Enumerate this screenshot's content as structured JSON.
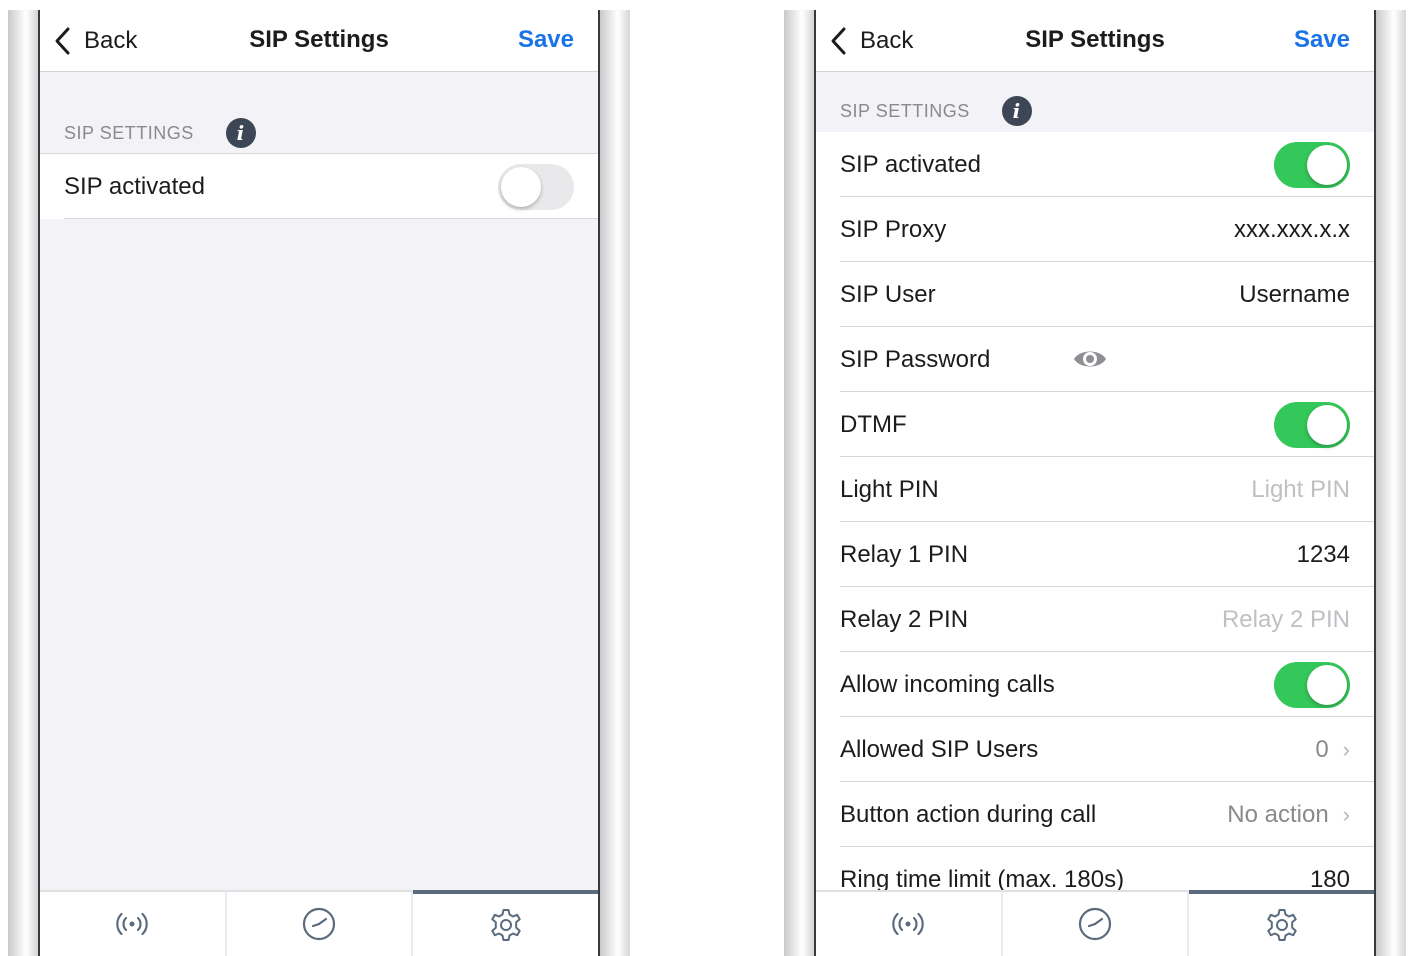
{
  "colors": {
    "accent": "#1a73e8",
    "toggle_on": "#34c759",
    "toggle_off": "#e9e9eb",
    "background": "#f2f2f7"
  },
  "left_screen": {
    "navbar": {
      "back_label": "Back",
      "title": "SIP Settings",
      "save_label": "Save"
    },
    "section_header": "SIP SETTINGS",
    "rows": [
      {
        "label": "SIP activated",
        "toggle": false
      }
    ],
    "tabs": [
      {
        "icon": "broadcast-icon",
        "active": false
      },
      {
        "icon": "clock-icon",
        "active": false
      },
      {
        "icon": "gear-icon",
        "active": true
      }
    ]
  },
  "right_screen": {
    "navbar": {
      "back_label": "Back",
      "title": "SIP Settings",
      "save_label": "Save"
    },
    "section_header": "SIP SETTINGS",
    "rows": [
      {
        "label": "SIP activated",
        "toggle": true
      },
      {
        "label": "SIP Proxy",
        "value": "xxx.xxx.x.x"
      },
      {
        "label": "SIP User",
        "value": "Username"
      },
      {
        "label": "SIP Password",
        "icon": "eye-icon"
      },
      {
        "label": "DTMF",
        "toggle": true
      },
      {
        "label": "Light PIN",
        "placeholder": "Light PIN"
      },
      {
        "label": "Relay 1 PIN",
        "value": "1234"
      },
      {
        "label": "Relay 2 PIN",
        "placeholder": "Relay 2 PIN"
      },
      {
        "label": "Allow incoming calls",
        "toggle": true
      },
      {
        "label": "Allowed SIP Users",
        "value": "0"
      },
      {
        "label": "Button action during call",
        "value": "No action"
      },
      {
        "label": "Ring time limit (max. 180s)",
        "value": "180"
      }
    ],
    "tabs": [
      {
        "icon": "broadcast-icon",
        "active": false
      },
      {
        "icon": "clock-icon",
        "active": false
      },
      {
        "icon": "gear-icon",
        "active": true
      }
    ]
  }
}
